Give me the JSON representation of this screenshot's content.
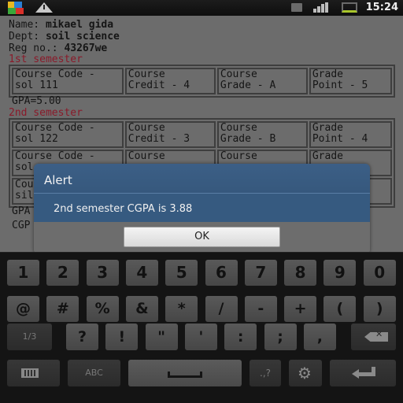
{
  "status_bar": {
    "time": "15:24",
    "icons": [
      "avg-antivirus-icon",
      "warning-icon",
      "sd-card-icon",
      "signal-icon",
      "battery-icon"
    ]
  },
  "student": {
    "name_label": "Name:",
    "name_value": "mikael gida",
    "dept_label": "Dept:",
    "dept_value": "soil science",
    "reg_label": "Reg no.:",
    "reg_value": "43267we"
  },
  "semesters": [
    {
      "title": "1st semester",
      "rows": [
        [
          "Course Code -\nsol 111",
          "Course\nCredit - 4",
          "Course\nGrade - A",
          "Grade\nPoint - 5"
        ]
      ],
      "gpa": "GPA=5.00"
    },
    {
      "title": "2nd semester",
      "rows": [
        [
          "Course Code -\nsol 122",
          "Course\nCredit - 3",
          "Course\nGrade - B",
          "Grade\nPoint - 4"
        ],
        [
          "Course Code -\nsol",
          "Course",
          "Course",
          "Grade"
        ],
        [
          "Cou\nsil",
          "",
          "",
          ""
        ]
      ],
      "gpa": "GPA",
      "cgpa": "CGP"
    }
  ],
  "dialog": {
    "title": "Alert",
    "message": "2nd semester CGPA is 3.88",
    "ok_label": "OK"
  },
  "keyboard": {
    "row1": [
      "1",
      "2",
      "3",
      "4",
      "5",
      "6",
      "7",
      "8",
      "9",
      "0"
    ],
    "row2": [
      "@",
      "#",
      "%",
      "&",
      "*",
      "/",
      "-",
      "+",
      "(",
      ")"
    ],
    "row3_page": "1/3",
    "row3": [
      "?",
      "!",
      "\"",
      "'",
      ":",
      ";",
      ","
    ],
    "row4_abc": "ABC",
    "row4_punct": ".,?"
  },
  "colors": {
    "semester_title": "#8a1a2a",
    "dialog_header": "#3c5f86",
    "dialog_body": "#365a80"
  }
}
